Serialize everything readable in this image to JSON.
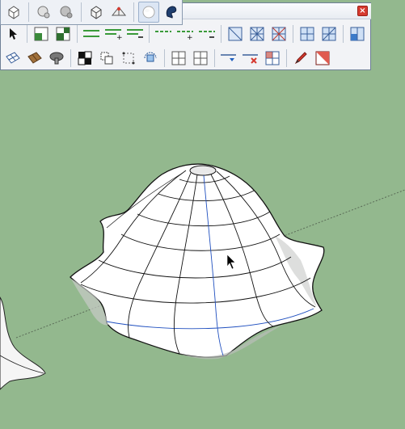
{
  "window": {
    "close_label": "×"
  },
  "styles_toolbar": {
    "buttons": [
      {
        "icon": "xray-icon"
      },
      {
        "icon": "back-edges-icon"
      },
      {
        "icon": "wireframe-icon"
      },
      {
        "icon": "hidden-line-icon"
      },
      {
        "icon": "shaded-icon"
      },
      {
        "icon": "shaded-textures-icon"
      },
      {
        "icon": "monochrome-icon",
        "active": true
      },
      {
        "icon": "sandbox-fredo-icon"
      }
    ]
  },
  "tools_row_1": [
    "select-icon",
    "make-component-icon",
    "make-group-icon",
    "line-spacing-icon",
    "line-add-icon",
    "line-remove-icon",
    "dash-line-icon",
    "dash-add-icon",
    "dash-remove-icon",
    "diagonal-grid-icon",
    "grid-cross-icon",
    "grid-cross-red-icon",
    "grid-blue-icon",
    "grid-split-icon",
    "grid-corner-icon"
  ],
  "tools_row_2": [
    "drape-grid-icon",
    "texture-icon",
    "mushroom-icon",
    "checker-icon",
    "fold-icon",
    "cube-dots-icon",
    "rotate-icon",
    "panel-grid-icon",
    "panel-grid-2-icon",
    "arrow-right-blue-icon",
    "delete-edge-icon",
    "quad-icon",
    "pencil-icon",
    "red-square-icon"
  ],
  "colors": {
    "background": "#93b88e",
    "toolbar": "#f2f3f6",
    "close": "#d63a2f"
  }
}
